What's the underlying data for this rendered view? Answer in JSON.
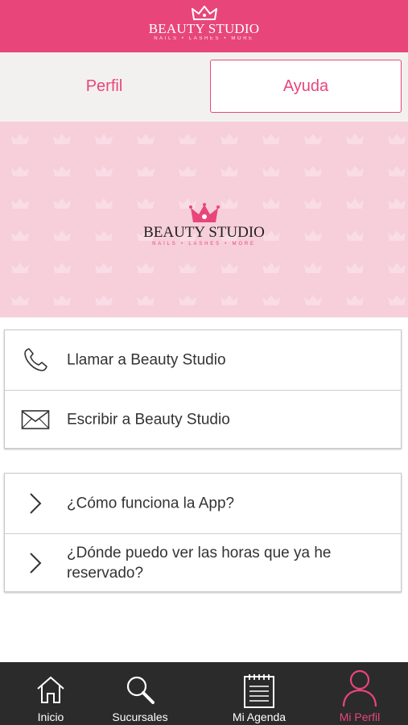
{
  "header": {
    "logo_title": "BEAUTY STUDIO",
    "logo_tagline": "NAILS • LASHES • MORE",
    "logo_icon": "crown-icon"
  },
  "tabs": [
    {
      "label": "Perfil",
      "selected": false
    },
    {
      "label": "Ayuda",
      "selected": true
    }
  ],
  "banner": {
    "logo_title": "BEAUTY STUDIO",
    "logo_tagline": "NAILS • LASHES • MORE"
  },
  "contact": {
    "items": [
      {
        "label": "Llamar a Beauty Studio",
        "icon": "phone-icon"
      },
      {
        "label": "Escribir a Beauty Studio",
        "icon": "envelope-icon"
      }
    ]
  },
  "help": {
    "items": [
      {
        "label": "¿Cómo funciona la App?",
        "icon": "chevron-right-icon"
      },
      {
        "label": "¿Dónde puedo ver las horas que ya he reservado?",
        "icon": "chevron-right-icon"
      }
    ]
  },
  "bottom_nav": [
    {
      "label": "Inicio",
      "icon": "home-icon",
      "active": false
    },
    {
      "label": "Sucursales",
      "icon": "search-icon",
      "active": false
    },
    {
      "label": "Mi Agenda",
      "icon": "calendar-icon",
      "active": false
    },
    {
      "label": "Mi Perfil",
      "icon": "user-icon",
      "active": true
    }
  ],
  "colors": {
    "brand_pink": "#e8467a",
    "banner_pink": "#f6cfdb",
    "nav_background": "#2b2b2b",
    "tabs_background": "#f3f1ef"
  }
}
